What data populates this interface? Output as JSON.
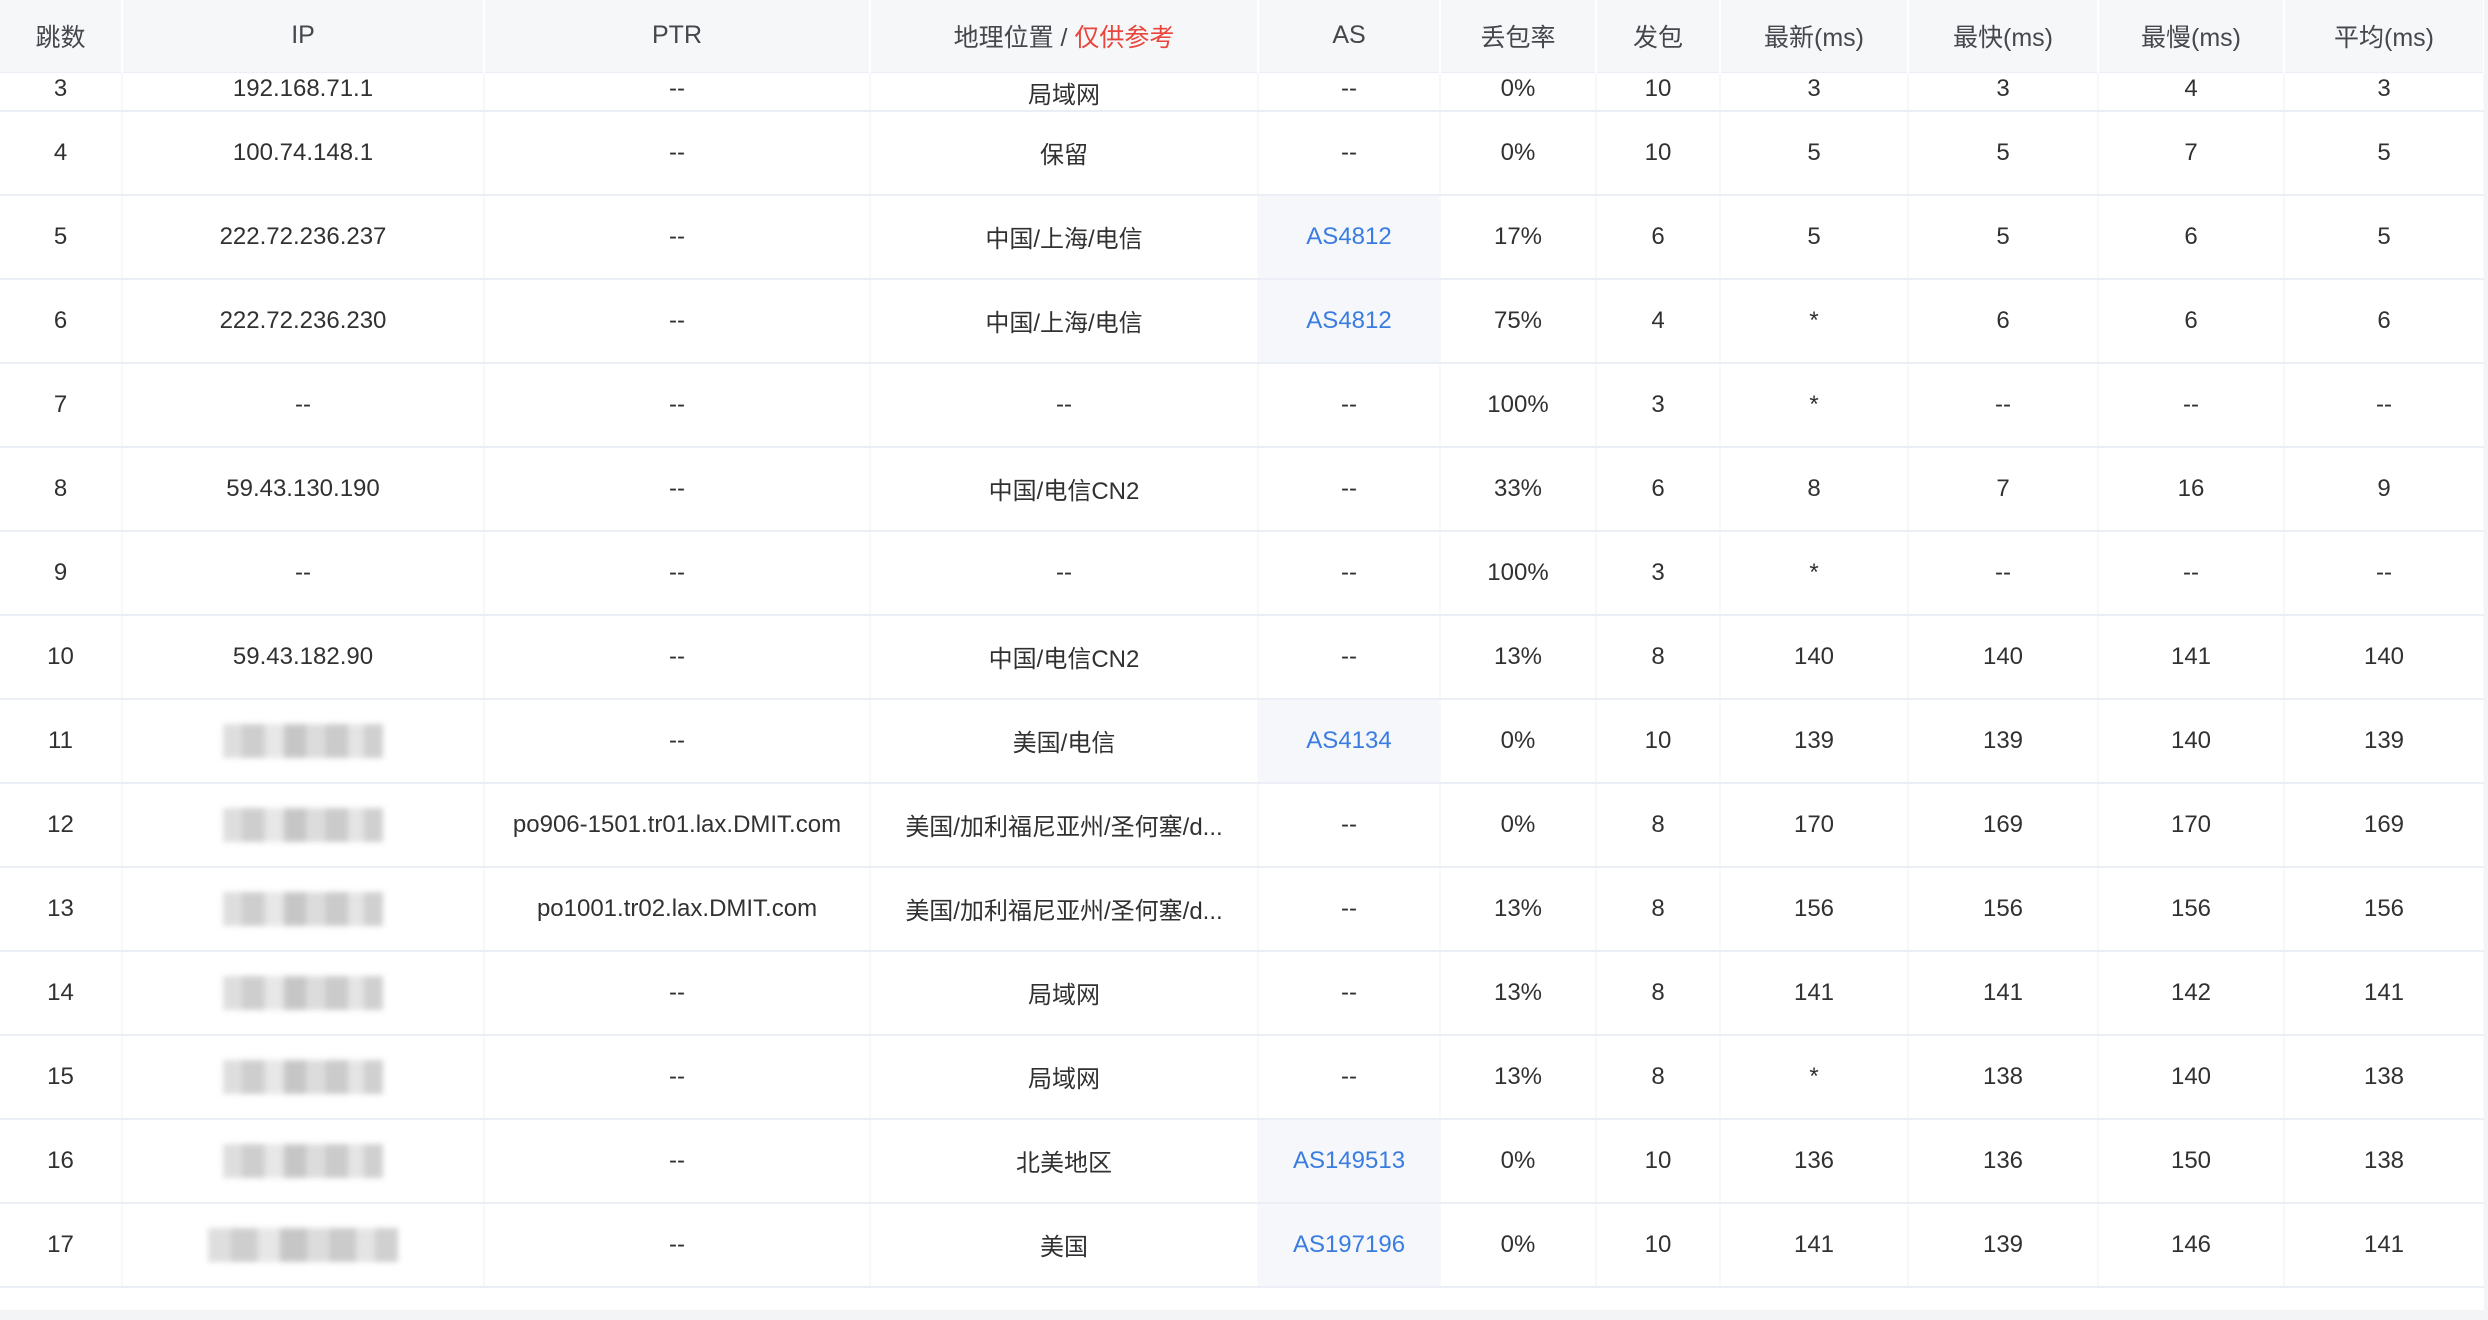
{
  "headers": {
    "hop": "跳数",
    "ip": "IP",
    "ptr": "PTR",
    "geo": "地理位置",
    "geo_sep": " / ",
    "geo_note": "仅供参考",
    "as": "AS",
    "loss": "丢包率",
    "sent": "发包",
    "last": "最新(ms)",
    "best": "最快(ms)",
    "worst": "最慢(ms)",
    "avg": "平均(ms)"
  },
  "rows": [
    {
      "hop": "3",
      "ip": "192.168.71.1",
      "ip_blurred": false,
      "ptr": "--",
      "geo": "局域网",
      "as": "--",
      "loss": "0%",
      "sent": "10",
      "last": "3",
      "best": "3",
      "worst": "4",
      "avg": "3"
    },
    {
      "hop": "4",
      "ip": "100.74.148.1",
      "ip_blurred": false,
      "ptr": "--",
      "geo": "保留",
      "as": "--",
      "loss": "0%",
      "sent": "10",
      "last": "5",
      "best": "5",
      "worst": "7",
      "avg": "5"
    },
    {
      "hop": "5",
      "ip": "222.72.236.237",
      "ip_blurred": false,
      "ptr": "--",
      "geo": "中国/上海/电信",
      "as": "AS4812",
      "loss": "17%",
      "sent": "6",
      "last": "5",
      "best": "5",
      "worst": "6",
      "avg": "5"
    },
    {
      "hop": "6",
      "ip": "222.72.236.230",
      "ip_blurred": false,
      "ptr": "--",
      "geo": "中国/上海/电信",
      "as": "AS4812",
      "loss": "75%",
      "sent": "4",
      "last": "*",
      "best": "6",
      "worst": "6",
      "avg": "6"
    },
    {
      "hop": "7",
      "ip": "--",
      "ip_blurred": false,
      "ptr": "--",
      "geo": "--",
      "as": "--",
      "loss": "100%",
      "sent": "3",
      "last": "*",
      "best": "--",
      "worst": "--",
      "avg": "--"
    },
    {
      "hop": "8",
      "ip": "59.43.130.190",
      "ip_blurred": false,
      "ptr": "--",
      "geo": "中国/电信CN2",
      "as": "--",
      "loss": "33%",
      "sent": "6",
      "last": "8",
      "best": "7",
      "worst": "16",
      "avg": "9"
    },
    {
      "hop": "9",
      "ip": "--",
      "ip_blurred": false,
      "ptr": "--",
      "geo": "--",
      "as": "--",
      "loss": "100%",
      "sent": "3",
      "last": "*",
      "best": "--",
      "worst": "--",
      "avg": "--"
    },
    {
      "hop": "10",
      "ip": "59.43.182.90",
      "ip_blurred": false,
      "ptr": "--",
      "geo": "中国/电信CN2",
      "as": "--",
      "loss": "13%",
      "sent": "8",
      "last": "140",
      "best": "140",
      "worst": "141",
      "avg": "140"
    },
    {
      "hop": "11",
      "ip": "",
      "ip_blurred": true,
      "ptr": "--",
      "geo": "美国/电信",
      "as": "AS4134",
      "loss": "0%",
      "sent": "10",
      "last": "139",
      "best": "139",
      "worst": "140",
      "avg": "139"
    },
    {
      "hop": "12",
      "ip": "",
      "ip_blurred": true,
      "ptr": "po906-1501.tr01.lax.DMIT.com",
      "geo": "美国/加利福尼亚州/圣何塞/d...",
      "as": "--",
      "loss": "0%",
      "sent": "8",
      "last": "170",
      "best": "169",
      "worst": "170",
      "avg": "169"
    },
    {
      "hop": "13",
      "ip": "",
      "ip_blurred": true,
      "ptr": "po1001.tr02.lax.DMIT.com",
      "geo": "美国/加利福尼亚州/圣何塞/d...",
      "as": "--",
      "loss": "13%",
      "sent": "8",
      "last": "156",
      "best": "156",
      "worst": "156",
      "avg": "156"
    },
    {
      "hop": "14",
      "ip": "",
      "ip_blurred": true,
      "ptr": "--",
      "geo": "局域网",
      "as": "--",
      "loss": "13%",
      "sent": "8",
      "last": "141",
      "best": "141",
      "worst": "142",
      "avg": "141"
    },
    {
      "hop": "15",
      "ip": "",
      "ip_blurred": true,
      "ptr": "--",
      "geo": "局域网",
      "as": "--",
      "loss": "13%",
      "sent": "8",
      "last": "*",
      "best": "138",
      "worst": "140",
      "avg": "138"
    },
    {
      "hop": "16",
      "ip": "",
      "ip_blurred": true,
      "ptr": "--",
      "geo": "北美地区",
      "as": "AS149513",
      "loss": "0%",
      "sent": "10",
      "last": "136",
      "best": "136",
      "worst": "150",
      "avg": "138"
    },
    {
      "hop": "17",
      "ip": "",
      "ip_blurred": true,
      "ptr": "--",
      "geo": "美国",
      "as": "AS197196",
      "loss": "0%",
      "sent": "10",
      "last": "141",
      "best": "139",
      "worst": "146",
      "avg": "141"
    }
  ],
  "colors": {
    "link": "#3a7ce0",
    "note": "#e8453c",
    "header_bg": "#f6f7f9",
    "as_cell_bg": "#f5f7fa"
  }
}
